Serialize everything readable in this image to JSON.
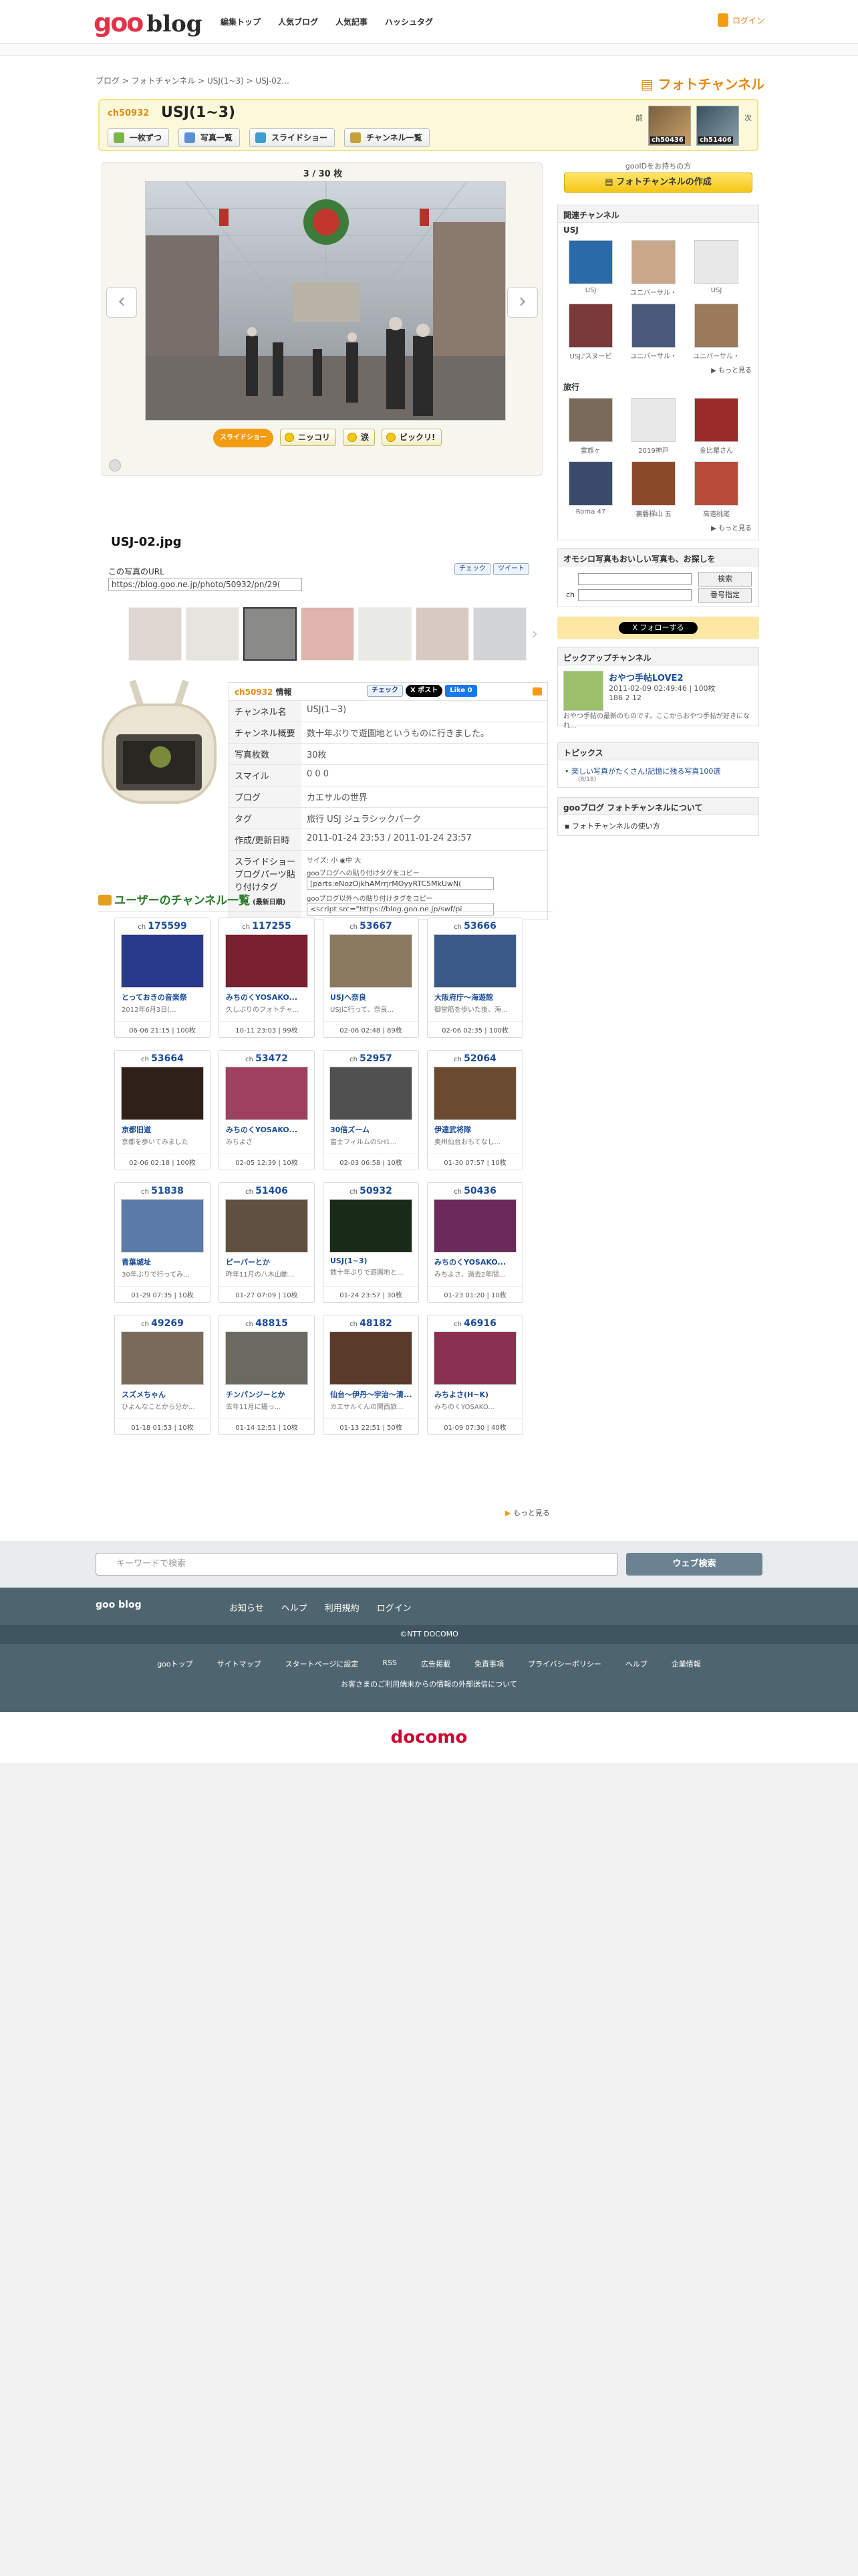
{
  "header": {
    "logo_goo": "goo",
    "logo_blog": "blog",
    "nav": [
      "編集トップ",
      "人気ブログ",
      "人気記事",
      "ハッシュタグ"
    ],
    "login": "ログイン"
  },
  "breadcrumb": "ブログ > フォトチャンネル > USJ(1~3) > USJ-02...",
  "photochannel_logo": "フォトチャンネル",
  "title": {
    "ch": "ch50932",
    "name": "USJ(1~3)",
    "buttons": [
      "一枚ずつ",
      "写真一覧",
      "スライドショー",
      "チャンネル一覧"
    ],
    "prev": "前",
    "next": "次",
    "prev_ch": "ch50436",
    "next_ch": "ch51406"
  },
  "viewer": {
    "count": "3 / 30 枚",
    "slide_label": "スライドショー",
    "smiles": [
      "ニッコリ",
      "涙",
      "ビックリ!"
    ]
  },
  "photo": {
    "name": "USJ-02.jpg",
    "url_label": "この写真のURL",
    "url": "https://blog.goo.ne.jp/photo/50932/pn/29(",
    "share": [
      "チェック",
      "ツイート"
    ]
  },
  "info": {
    "header": "情報",
    "header_ch": "ch50932",
    "share": [
      "チェック",
      "X ポスト",
      "Like 0"
    ],
    "rows": [
      {
        "k": "チャンネル名",
        "v": "USJ(1~3)"
      },
      {
        "k": "チャンネル概要",
        "v": "数十年ぶりで遊園地というものに行きました。"
      },
      {
        "k": "写真枚数",
        "v": "30枚"
      },
      {
        "k": "スマイル",
        "v": "0 0 0"
      },
      {
        "k": "ブログ",
        "v": "カエサルの世界"
      },
      {
        "k": "タグ",
        "v": "旅行 USJ ジュラシックパーク"
      },
      {
        "k": "作成/更新日時",
        "v": "2011-01-24 23:53 / 2011-01-24 23:57"
      },
      {
        "k": "スライドショーブログパーツ貼り付けタグ",
        "v": "サイズ: 小 ◉中 大"
      }
    ],
    "tag1_label": "gooブログへの貼り付けタグをコピー",
    "tag1": "[parts:eNozOjkhAMrrjrMOyyRTC5MkUwN(",
    "tag2_label": "gooブログ以外への貼り付けタグをコピー",
    "tag2": "<script src=\"https://blog.goo.ne.jp/swf/pi"
  },
  "channels": {
    "title": "ユーザーのチャンネル一覧",
    "subtitle": "(最新日順)",
    "more": "もっと見る",
    "items": [
      {
        "ch": "175599",
        "title": "とっておきの音楽祭",
        "desc": "2012年6月3日(...",
        "date": "06-06 21:15 | 100枚"
      },
      {
        "ch": "117255",
        "title": "みちのくYOSAKO...",
        "desc": "久しぶりのフォトチャ...",
        "date": "10-11 23:03 | 99枚"
      },
      {
        "ch": "53667",
        "title": "USJへ奈良",
        "desc": "USJに行って、奈良...",
        "date": "02-06 02:48 | 89枚"
      },
      {
        "ch": "53666",
        "title": "大阪府庁～海遊館",
        "desc": "御堂筋を歩いた後、海...",
        "date": "02-06 02:35 | 100枚"
      },
      {
        "ch": "53664",
        "title": "京都旧道",
        "desc": "京都を歩いてみました",
        "date": "02-06 02:18 | 100枚"
      },
      {
        "ch": "53472",
        "title": "みちのくYOSAKO...",
        "desc": "みちよさ",
        "date": "02-05 12:39 | 10枚"
      },
      {
        "ch": "52957",
        "title": "30倍ズーム",
        "desc": "富士フィルムのSH1...",
        "date": "02-03 06:58 | 10枚"
      },
      {
        "ch": "52064",
        "title": "伊達武将隊",
        "desc": "奥州仙台おもてなし...",
        "date": "01-30 07:57 | 10枚"
      },
      {
        "ch": "51838",
        "title": "青葉城址",
        "desc": "30年ぶりで行ってみ...",
        "date": "01-29 07:35 | 10枚"
      },
      {
        "ch": "51406",
        "title": "ピーパーとか",
        "desc": "昨年11月の八木山動...",
        "date": "01-27 07:09 | 10枚"
      },
      {
        "ch": "50932",
        "title": "USJ(1~3)",
        "desc": "数十年ぶりで遊園地と...",
        "date": "01-24 23:57 | 30枚"
      },
      {
        "ch": "50436",
        "title": "みちのくYOSAKO...",
        "desc": "みちよさ、過去2年間...",
        "date": "01-23 01:20 | 10枚"
      },
      {
        "ch": "49269",
        "title": "スズメちゃん",
        "desc": "ひよんなことから分か...",
        "date": "01-18 01:53 | 10枚"
      },
      {
        "ch": "48815",
        "title": "チンパンジーとか",
        "desc": "去年11月に撮っ...",
        "date": "01-14 12:51 | 10枚"
      },
      {
        "ch": "48182",
        "title": "仙台～伊丹～宇治～清...",
        "desc": "カエサルくんの関西旅...",
        "date": "01-13 22:51 | 50枚"
      },
      {
        "ch": "46916",
        "title": "みちよさ(H~K)",
        "desc": "みちのくYOSAKO...",
        "date": "01-09 07:30 | 40枚"
      }
    ]
  },
  "right": {
    "goo_id": "gooIDをお持ちの方",
    "create": "フォトチャンネルの作成",
    "related": "関連チャンネル",
    "cat1": "USJ",
    "cat1_items": [
      "USJ",
      "ユニバーサル・",
      "USJ",
      "USJ♪スヌーピ",
      "ユニバーサル・",
      "ユニバーサル・"
    ],
    "cat2": "旅行",
    "cat2_items": [
      "雷族ヶ",
      "2019神戸",
      "金比羅さん",
      "Roma 47",
      "裏磐梯山 五",
      "高遠桃尾"
    ],
    "more": "もっと見る",
    "search_title": "オモシロ写真もおいしい写真も、お探しを",
    "search_btn": "検索",
    "ch_label": "ch",
    "ch_btn": "番号指定",
    "follow": "フォローする",
    "pickup": "ピックアップチャンネル",
    "pickup_title": "おやつ手帖LOVE2",
    "pickup_meta": "2011-02-09 02:49:46 | 100枚",
    "pickup_smiles": "186 2 12",
    "pickup_desc": "おやつ手帖の最新のものです。ここからおやつ手帖が好きになれ...",
    "topics": "トピックス",
    "topic1": "楽しい写真がたくさん!記憶に残る写真100選",
    "topic1_sub": "(8/18)",
    "about": "gooブログ フォトチャンネルについて",
    "about_link": "フォトチャンネルの使い方"
  },
  "footer": {
    "search_ph": "キーワードで検索",
    "search_btn": "ウェブ検索",
    "brand": "goo blog",
    "links1": [
      "お知らせ",
      "ヘルプ",
      "利用規約",
      "ログイン"
    ],
    "copyright": "©NTT DOCOMO",
    "links2": [
      "gooトップ",
      "サイトマップ",
      "スタートページに設定",
      "RSS",
      "広告掲載",
      "免責事項",
      "プライバシーポリシー",
      "ヘルプ",
      "企業情報"
    ],
    "note": "お客さまのご利用端末からの情報の外部送信について",
    "docomo": "docomo"
  }
}
